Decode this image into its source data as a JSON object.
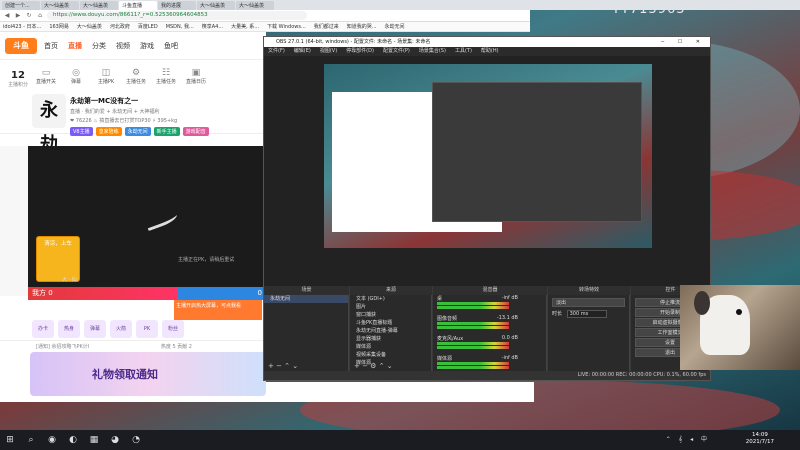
{
  "browser": {
    "tabs": [
      "创建一个...",
      "大～仙盖羡",
      "大～仙盖羡",
      "斗鱼直播",
      "我的进展",
      "大～仙盖羡",
      "大～仙盖羡"
    ],
    "url": "https://www.douyu.com/86611?_r=0.525360964604853",
    "bookmarks": [
      "idol423 - 日本...",
      "163网易",
      "大～仙盖羡",
      "河北政府",
      "百度LED",
      "MSDN, 我...",
      "筷享A4...",
      "大量美, 系...",
      "下载 Windows...",
      "我们都过来",
      "知道我的哭...",
      "永劫无间"
    ]
  },
  "douyu": {
    "logo": "斗鱼",
    "nav": [
      "首页",
      "直播",
      "分类",
      "视频",
      "游戏",
      "鱼吧"
    ],
    "tools": [
      {
        "icon": "▭",
        "label": "直播开关"
      },
      {
        "icon": "◎",
        "label": "弹幕"
      },
      {
        "icon": "◫",
        "label": "主播PK"
      },
      {
        "icon": "⚙",
        "label": "主播任务"
      },
      {
        "icon": "☷",
        "label": "主播任务"
      },
      {
        "icon": "▣",
        "label": "直播日历"
      }
    ],
    "level": {
      "value": "12",
      "label": "主播积分"
    },
    "room": {
      "avatar": "永劫",
      "title": "永劫第一MC没有之一",
      "sub1": "直播 · 我们的爱 + 永劫无间 + 大神福利",
      "sub2": "❤ 76226   ♨ 搞直播去已打赏TOP30   ⚡ 395+kg",
      "tags": [
        "V8主播",
        "皇家陪练",
        "永劫无间",
        "新手主播",
        "游戏配音"
      ]
    },
    "player_text": "主播正在PK，请稍后重试",
    "hot_badge": "清凉，上车",
    "pk": {
      "left_label": "斗鱼 0",
      "left": "我方 0",
      "right": "0"
    },
    "pk_label": "大 · 仙",
    "notice": "主播开启热大屏幕，可点我看",
    "gifts": [
      "办卡",
      "热身",
      "弹幕",
      "火箭",
      "PK",
      "粉丝"
    ],
    "bottom_text": "[通知] 余招攻略飞PK计I",
    "bottom_stats": "热度 5    贡献 2",
    "banner": "礼物领取通知"
  },
  "obs": {
    "title": "OBS 27.0.1 (64-bit, windows) - 配置文件: 未命名 - 场景集: 未命名",
    "menu": [
      "文件(F)",
      "编辑(E)",
      "视图(V)",
      "停靠部件(D)",
      "配置文件(P)",
      "场景集合(S)",
      "工具(T)",
      "帮助(H)"
    ],
    "docks": {
      "scenes": "场景",
      "sources": "来源",
      "mixer": "混音器",
      "transitions": "转场特效",
      "controls": "控件"
    },
    "scene_items": [
      "永劫无间"
    ],
    "source_items": [
      "文本 (GDI+)",
      "图片",
      "窗口捕获",
      "斗鱼PK直播标题",
      "永劫无间直播-弹幕",
      "显示器捕获",
      "媒体源",
      "视频采集设备",
      "媒体源"
    ],
    "mixer": [
      {
        "name": "桌",
        "db": "-inf dB"
      },
      {
        "name": "图像音频",
        "db": "-13.1 dB"
      },
      {
        "name": "麦克风/Aux",
        "db": "0.0 dB"
      },
      {
        "name": "媒体源",
        "db": "-inf dB"
      }
    ],
    "transition": {
      "type": "淡出",
      "duration_label": "时长",
      "duration": "300 ms"
    },
    "controls": [
      "停止推流",
      "开始录制",
      "启动虚拟摄像机",
      "工作室模式",
      "设置",
      "退出"
    ],
    "status": "LIVE: 00:00:00   REC: 00:00:00   CPU: 0.1%, 60.00 fps"
  },
  "watermark": "YY713963",
  "taskbar": {
    "icons": [
      "⊞",
      "⌕",
      "◉",
      "◐",
      "▦",
      "◕",
      "◔"
    ],
    "tray": "⌃ 𝄞 ◂ 中",
    "time": "14:09",
    "date": "2021/7/17"
  }
}
